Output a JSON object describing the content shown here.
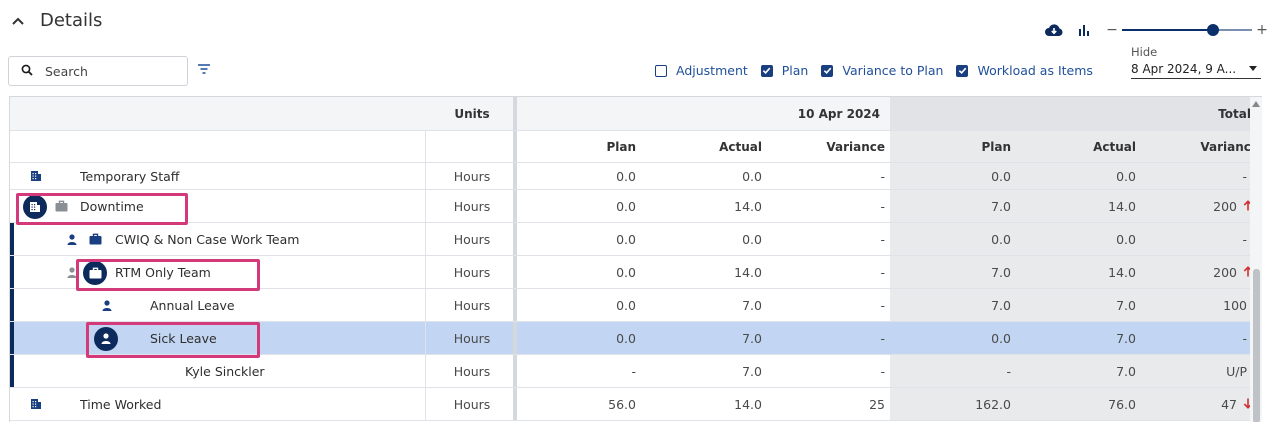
{
  "details": {
    "title": "Details"
  },
  "toolbar": {
    "search_placeholder": "Search",
    "zoom": {
      "level_fraction": 0.7
    },
    "toggles": [
      {
        "label": "Adjustment",
        "checked": false
      },
      {
        "label": "Plan",
        "checked": true
      },
      {
        "label": "Variance to Plan",
        "checked": true
      },
      {
        "label": "Workload as Items",
        "checked": true
      }
    ],
    "hide": {
      "label": "Hide",
      "value": "8 Apr 2024, 9 A..."
    }
  },
  "table": {
    "header": {
      "units": "Units",
      "date": "10 Apr 2024",
      "total": "Total",
      "plan": "Plan",
      "actual": "Actual",
      "variance": "Variance"
    },
    "rows": [
      {
        "name": "Temporary Staff",
        "units": "Hours",
        "d_plan": "0.0",
        "d_actual": "0.0",
        "d_var": "-",
        "t_plan": "0.0",
        "t_actual": "0.0",
        "t_var": "-"
      },
      {
        "name": "Downtime",
        "units": "Hours",
        "d_plan": "0.0",
        "d_actual": "14.0",
        "d_var": "-",
        "t_plan": "7.0",
        "t_actual": "14.0",
        "t_var": "200"
      },
      {
        "name": "CWIQ & Non Case Work Team",
        "units": "Hours",
        "d_plan": "0.0",
        "d_actual": "0.0",
        "d_var": "-",
        "t_plan": "0.0",
        "t_actual": "0.0",
        "t_var": "-"
      },
      {
        "name": "RTM Only Team",
        "units": "Hours",
        "d_plan": "0.0",
        "d_actual": "14.0",
        "d_var": "-",
        "t_plan": "7.0",
        "t_actual": "14.0",
        "t_var": "200"
      },
      {
        "name": "Annual Leave",
        "units": "Hours",
        "d_plan": "0.0",
        "d_actual": "7.0",
        "d_var": "-",
        "t_plan": "7.0",
        "t_actual": "7.0",
        "t_var": "100"
      },
      {
        "name": "Sick Leave",
        "units": "Hours",
        "d_plan": "0.0",
        "d_actual": "7.0",
        "d_var": "-",
        "t_plan": "0.0",
        "t_actual": "7.0",
        "t_var": "-"
      },
      {
        "name": "Kyle Sinckler",
        "units": "Hours",
        "d_plan": "-",
        "d_actual": "7.0",
        "d_var": "-",
        "t_plan": "-",
        "t_actual": "7.0",
        "t_var": "U/P"
      },
      {
        "name": "Time Worked",
        "units": "Hours",
        "d_plan": "56.0",
        "d_actual": "14.0",
        "d_var": "25",
        "t_plan": "162.0",
        "t_actual": "76.0",
        "t_var": "47"
      }
    ]
  },
  "colors": {
    "accent": "#0d2a5c",
    "highlight": "#d4397a",
    "selected_row": "#c2d6f3",
    "up_arrow": "#d32f2f",
    "down_arrow": "#d32f2f"
  },
  "icons": [
    "chevron-up-icon",
    "cloud-download-icon",
    "bar-chart-icon",
    "search-icon",
    "filter-icon",
    "building-icon",
    "briefcase-icon",
    "person-icon",
    "arrow-up-icon",
    "arrow-down-icon"
  ]
}
